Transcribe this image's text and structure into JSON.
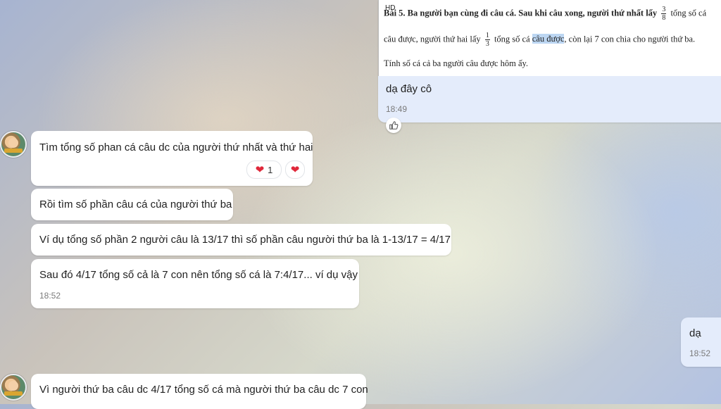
{
  "image_message": {
    "hd_badge": "HD",
    "line1_a": "Bài 5. Ba người bạn cùng đi câu cá. Sau khi câu xong, người thứ nhất lấy",
    "frac1_num": "3",
    "frac1_den": "8",
    "line1_b": "tổng số cá",
    "line2_a": "câu được, người thứ hai lấy",
    "frac2_num": "1",
    "frac2_den": "3",
    "line2_b": "tổng số cá",
    "line2_hl": "câu được",
    "line2_c": ", còn lại 7 con chia cho người thứ ba.",
    "line3": "Tính số cá cả ba người câu được hôm ấy.",
    "caption": "dạ đây cô",
    "time": "18:49",
    "like_icon": "thumbs-up"
  },
  "messages": [
    {
      "text": "Tìm tổng số phan cá câu dc của người thứ nhất và thứ hai",
      "reaction_count": "1"
    },
    {
      "text": "Rồi tìm số phần câu cá của người thứ ba"
    },
    {
      "text": "Ví dụ tổng số phần 2 người câu là 13/17 thì số phần câu người thứ ba là 1-13/17 = 4/17"
    },
    {
      "text": "Sau đó 4/17 tổng số cả là  7 con nên tổng số cá là 7:4/17... ví dụ vậy",
      "time": "18:52"
    },
    {
      "text": "dạ",
      "time": "18:52"
    },
    {
      "text": "Vì người thứ ba câu dc 4/17 tổng số cá mà người thứ ba câu dc 7 con"
    }
  ],
  "colors": {
    "outgoing_bubble": "#e4ecfb",
    "incoming_bubble": "#ffffff",
    "heart": "#e0283a"
  }
}
